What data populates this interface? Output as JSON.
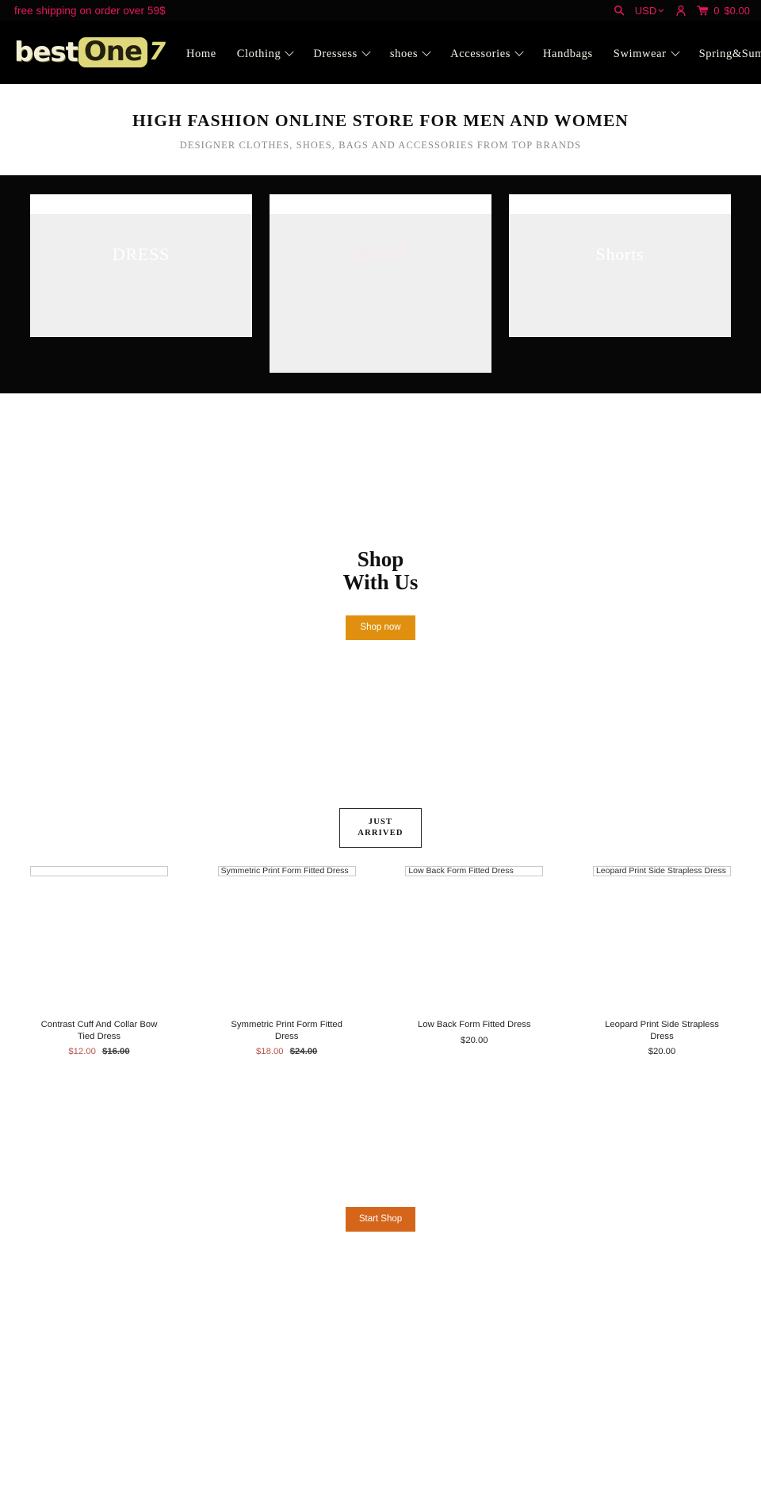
{
  "announcement": {
    "text": "free shipping on order over 59$",
    "search_icon": "search-icon",
    "currency": "USD",
    "account_icon": "account-icon",
    "cart_icon": "cart-icon",
    "cart_count": "0",
    "cart_total": "$0.00",
    "accent_color": "#e8175d"
  },
  "header": {
    "logo": {
      "part1": "best",
      "part2": "One",
      "part3": "7",
      "badge_color": "#ded87a"
    },
    "nav": [
      {
        "label": "Home",
        "has_dropdown": false
      },
      {
        "label": "Clothing",
        "has_dropdown": true
      },
      {
        "label": "Dressess",
        "has_dropdown": true
      },
      {
        "label": "shoes",
        "has_dropdown": true
      },
      {
        "label": "Accessories",
        "has_dropdown": true
      },
      {
        "label": "Handbags",
        "has_dropdown": false
      },
      {
        "label": "Swimwear",
        "has_dropdown": true
      },
      {
        "label": "Spring&Summer",
        "has_dropdown": false
      }
    ]
  },
  "hero": {
    "title": "HIGH FASHION ONLINE STORE FOR MEN AND WOMEN",
    "subtitle": "DESIGNER CLOTHES, SHOES, BAGS AND ACCESSORIES FROM TOP BRANDS"
  },
  "categories": [
    {
      "label": "DRESS",
      "style": "white"
    },
    {
      "label": "JEANS",
      "style": "faint"
    },
    {
      "label": "Shorts",
      "style": "white"
    }
  ],
  "shop_with_us": {
    "heading_line1": "Shop With",
    "heading_line2": "Us",
    "button_label": "Shop now",
    "button_color": "#e0900e"
  },
  "just_arrived": {
    "line1": "JUST",
    "line2": "ARRIVED"
  },
  "products": [
    {
      "alt_text": "",
      "title": "Contrast Cuff And Collar Bow Tied Dress",
      "price": "$12.00",
      "compare_at": "$16.00",
      "on_sale": true
    },
    {
      "alt_text": "Symmetric Print Form Fitted Dress",
      "title": "Symmetric Print Form Fitted Dress",
      "price": "$18.00",
      "compare_at": "$24.00",
      "on_sale": true
    },
    {
      "alt_text": "Low Back Form Fitted Dress",
      "title": "Low Back Form Fitted Dress",
      "price": "$20.00",
      "compare_at": "",
      "on_sale": false
    },
    {
      "alt_text": "Leopard Print Side Strapless Dress",
      "title": "Leopard Print Side Strapless Dress",
      "price": "$20.00",
      "compare_at": "",
      "on_sale": false
    }
  ],
  "start_shop": {
    "button_label": "Start Shop",
    "button_color": "#d4651a"
  }
}
